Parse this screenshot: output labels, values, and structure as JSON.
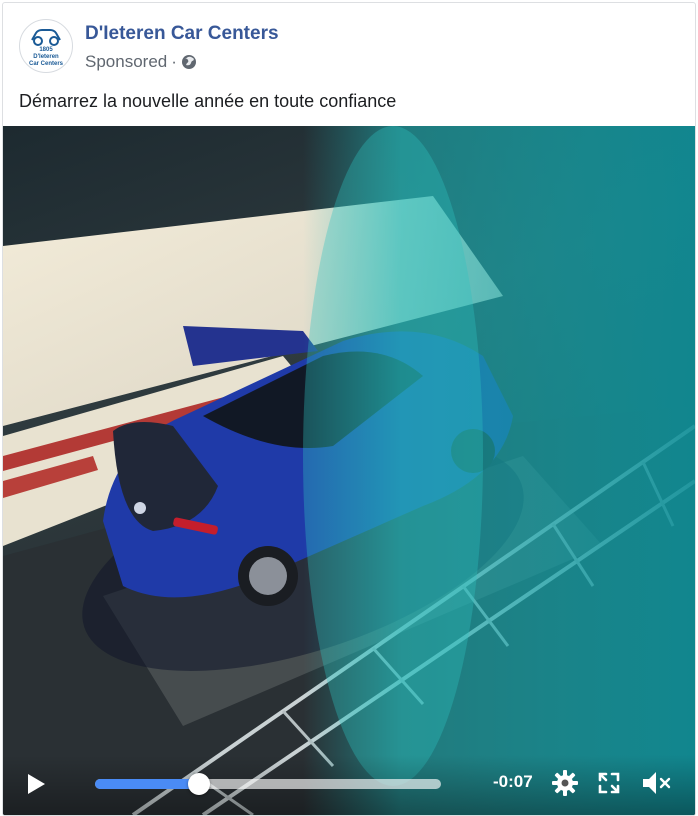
{
  "post": {
    "page_name": "D'Ieteren Car Centers",
    "sponsored_label": "Sponsored",
    "meta_separator": "·",
    "audience_icon": "globe-icon",
    "caption": "Démarrez la nouvelle année en toute confiance",
    "avatar_lines": [
      "1805",
      "D'Ieteren",
      "Car Centers"
    ]
  },
  "video": {
    "subject": "blue hatchback car",
    "controls": {
      "play_icon": "play-icon",
      "time_remaining": "-0:07",
      "progress_fraction": 0.3,
      "settings_icon": "gear-icon",
      "fullscreen_icon": "fullscreen-icon",
      "mute_icon": "speaker-muted-icon"
    }
  },
  "colors": {
    "link_blue": "#385898",
    "progress_blue": "#4a8bf5",
    "car_blue": "#1f3aa8",
    "teal_overlay": "#1bb6b8"
  }
}
